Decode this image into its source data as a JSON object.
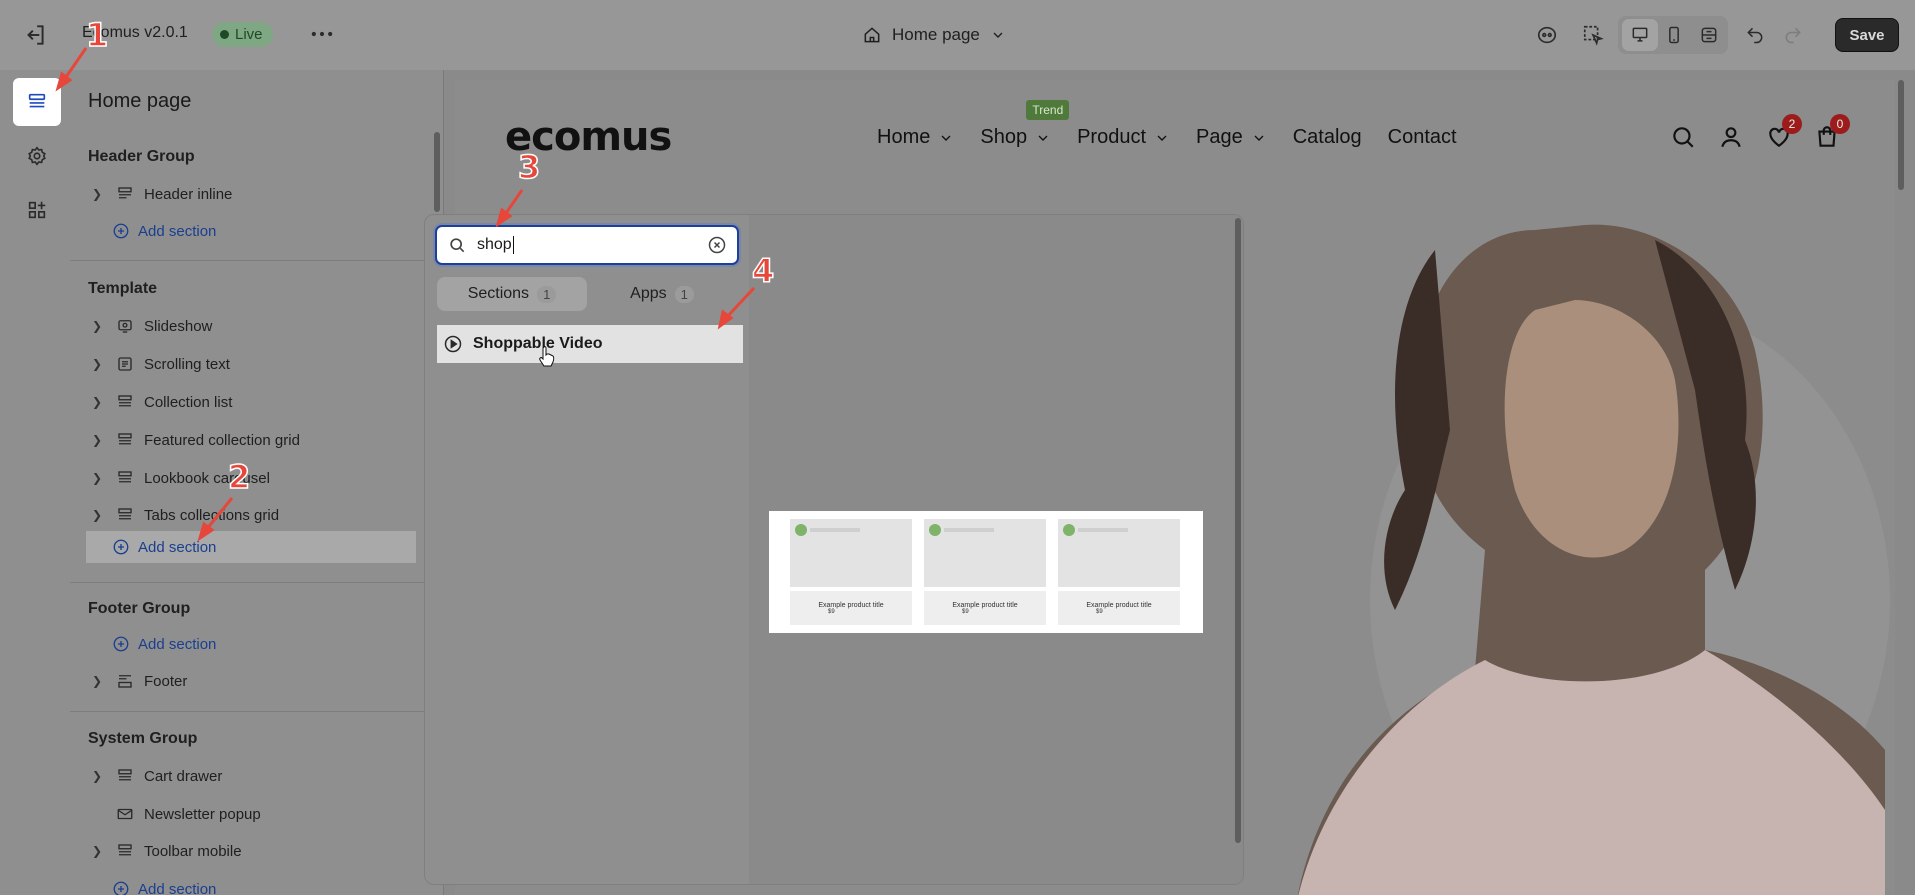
{
  "topbar": {
    "app_title": "Ecomus v2.0.1",
    "live_label": "Live",
    "page_select": "Home page",
    "save_label": "Save"
  },
  "sidebar": {
    "title": "Home page",
    "groups": {
      "header": {
        "title": "Header Group",
        "items": [
          "Header inline"
        ],
        "add_label": "Add section"
      },
      "template": {
        "title": "Template",
        "items": [
          "Slideshow",
          "Scrolling text",
          "Collection list",
          "Featured collection grid",
          "Lookbook carousel",
          "Tabs collections grid"
        ],
        "add_label": "Add section"
      },
      "footer": {
        "title": "Footer Group",
        "add_label": "Add section",
        "items": [
          "Footer"
        ]
      },
      "system": {
        "title": "System Group",
        "items": [
          "Cart drawer",
          "Newsletter popup",
          "Toolbar mobile"
        ],
        "add_label": "Add section"
      }
    }
  },
  "popup": {
    "search_value": "shop",
    "tabs": [
      {
        "label": "Sections",
        "count": "1"
      },
      {
        "label": "Apps",
        "count": "1"
      }
    ],
    "result": "Shoppable Video",
    "thumb": {
      "card_title": "Example product title",
      "card_price": "$9"
    }
  },
  "store": {
    "logo": "ecomus",
    "nav": [
      "Home",
      "Shop",
      "Product",
      "Page",
      "Catalog",
      "Contact"
    ],
    "trend_badge": "Trend",
    "wishlist_count": "2",
    "cart_count": "0"
  },
  "markers": [
    "1",
    "2",
    "3",
    "4"
  ],
  "colors": {
    "accent": "#1c3f9c",
    "live": "#7fa784",
    "marker": "#e6473a",
    "badge": "#9c1b1b"
  }
}
